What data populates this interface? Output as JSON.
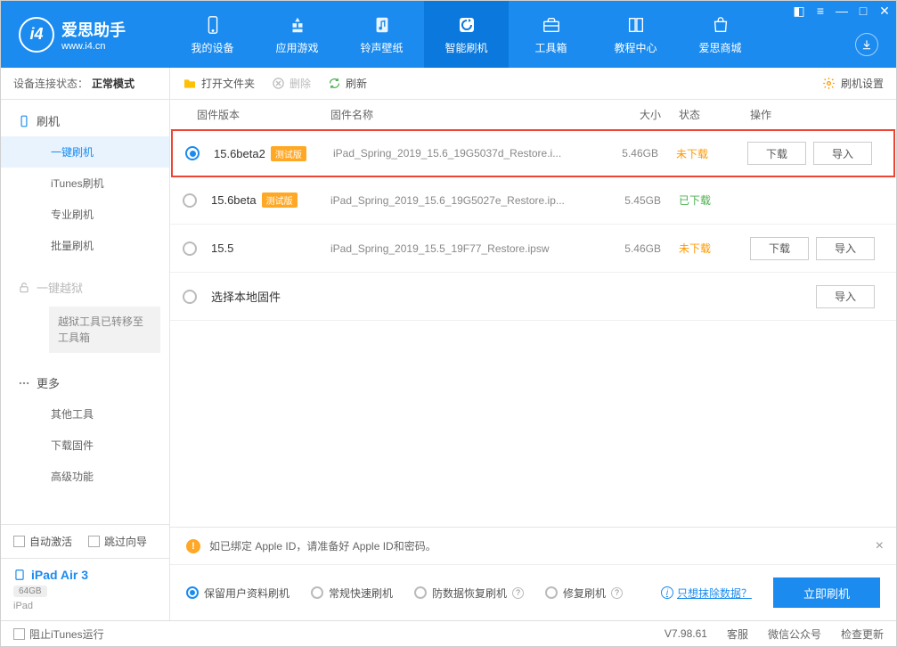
{
  "app": {
    "title": "爱思助手",
    "subtitle": "www.i4.cn"
  },
  "nav": {
    "tabs": [
      {
        "label": "我的设备"
      },
      {
        "label": "应用游戏"
      },
      {
        "label": "铃声壁纸"
      },
      {
        "label": "智能刷机"
      },
      {
        "label": "工具箱"
      },
      {
        "label": "教程中心"
      },
      {
        "label": "爱思商城"
      }
    ]
  },
  "status": {
    "label": "设备连接状态：",
    "value": "正常模式"
  },
  "sidebar": {
    "flash_header": "刷机",
    "items": {
      "one_click": "一键刷机",
      "itunes": "iTunes刷机",
      "pro": "专业刷机",
      "batch": "批量刷机"
    },
    "jailbreak_header": "一键越狱",
    "jailbreak_note": "越狱工具已转移至工具箱",
    "more_header": "更多",
    "more_items": {
      "other_tools": "其他工具",
      "download_fw": "下载固件",
      "advanced": "高级功能"
    },
    "auto_activate": "自动激活",
    "skip_guide": "跳过向导"
  },
  "device": {
    "name": "iPad Air 3",
    "storage": "64GB",
    "type": "iPad"
  },
  "toolbar": {
    "open_folder": "打开文件夹",
    "delete": "删除",
    "refresh": "刷新",
    "settings": "刷机设置"
  },
  "table": {
    "headers": {
      "version": "固件版本",
      "name": "固件名称",
      "size": "大小",
      "status": "状态",
      "action": "操作"
    },
    "rows": [
      {
        "version": "15.6beta2",
        "beta": "测试版",
        "name": "iPad_Spring_2019_15.6_19G5037d_Restore.i...",
        "size": "5.46GB",
        "status": "未下载",
        "status_class": "nd",
        "selected": true,
        "btn_dl": "下载",
        "btn_imp": "导入",
        "highlight": true
      },
      {
        "version": "15.6beta",
        "beta": "测试版",
        "name": "iPad_Spring_2019_15.6_19G5027e_Restore.ip...",
        "size": "5.45GB",
        "status": "已下载",
        "status_class": "dl",
        "selected": false
      },
      {
        "version": "15.5",
        "name": "iPad_Spring_2019_15.5_19F77_Restore.ipsw",
        "size": "5.46GB",
        "status": "未下载",
        "status_class": "nd",
        "selected": false,
        "btn_dl": "下载",
        "btn_imp": "导入"
      }
    ],
    "local_row": {
      "label": "选择本地固件",
      "btn": "导入"
    }
  },
  "warn": {
    "text": "如已绑定 Apple ID，请准备好 Apple ID和密码。"
  },
  "options": {
    "keep_data": "保留用户资料刷机",
    "normal": "常规快速刷机",
    "anti_data": "防数据恢复刷机",
    "repair": "修复刷机",
    "erase_link": "只想抹除数据？",
    "flash_btn": "立即刷机"
  },
  "footer": {
    "block_itunes": "阻止iTunes运行",
    "version": "V7.98.61",
    "support": "客服",
    "wechat": "微信公众号",
    "check_update": "检查更新"
  }
}
